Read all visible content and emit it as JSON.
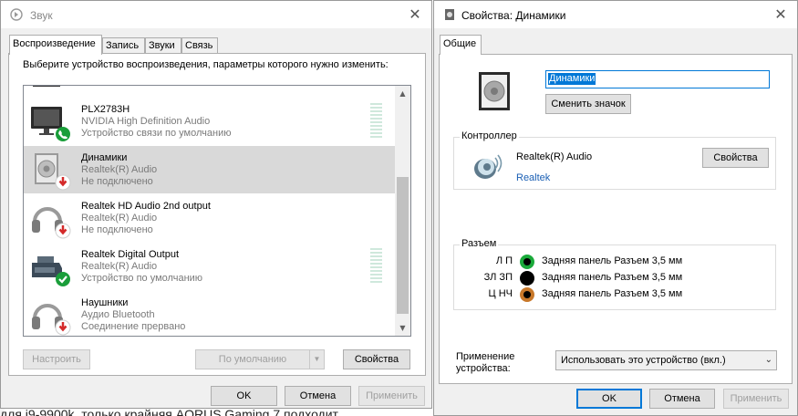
{
  "background": {
    "text": "для i9-9900k, только крайняя AORUS Gaming 7 подходит"
  },
  "sound_window": {
    "title": "Звук",
    "tabs": [
      "Воспроизведение",
      "Запись",
      "Звуки",
      "Связь"
    ],
    "instruction": "Выберите устройство воспроизведения, параметры которого нужно изменить:",
    "devices": [
      {
        "name": "PLX2783H",
        "sub": "NVIDIA High Definition Audio",
        "status": "Устройство связи по умолчанию",
        "icon": "monitor-phone-icon"
      },
      {
        "name": "Динамики",
        "sub": "Realtek(R) Audio",
        "status": "Не подключено",
        "icon": "speaker-disconnected-icon"
      },
      {
        "name": "Realtek HD Audio 2nd output",
        "sub": "Realtek(R) Audio",
        "status": "Не подключено",
        "icon": "headphones-disconnected-icon"
      },
      {
        "name": "Realtek Digital Output",
        "sub": "Realtek(R) Audio",
        "status": "Устройство по умолчанию",
        "icon": "digital-output-default-icon"
      },
      {
        "name": "Наушники",
        "sub": "Аудио Bluetooth",
        "status": "Соединение прервано",
        "icon": "headphones-disconnected-icon"
      }
    ],
    "buttons": {
      "configure": "Настроить",
      "set_default": "По умолчанию",
      "properties": "Свойства",
      "ok": "OK",
      "cancel": "Отмена",
      "apply": "Применить"
    }
  },
  "props_window": {
    "title": "Свойства: Динамики",
    "tab": "Общие",
    "name_value": "Динамики",
    "change_icon": "Сменить значок",
    "controller": {
      "label": "Контроллер",
      "name": "Realtek(R) Audio",
      "vendor": "Realtek",
      "properties_button": "Свойства"
    },
    "jacks": {
      "label": "Разъем",
      "items": [
        {
          "channel": "Л П",
          "desc": "Задняя панель Разъем 3,5 мм",
          "color": "#1aaa3a"
        },
        {
          "channel": "ЗЛ ЗП",
          "desc": "Задняя панель Разъем 3,5 мм",
          "color": "#000000"
        },
        {
          "channel": "Ц НЧ",
          "desc": "Задняя панель Разъем 3,5 мм",
          "color": "#c8782a"
        }
      ]
    },
    "usage": {
      "label_line1": "Применение",
      "label_line2": "устройства:",
      "value": "Использовать это устройство (вкл.)"
    },
    "buttons": {
      "ok": "OK",
      "cancel": "Отмена",
      "apply": "Применить"
    }
  },
  "colors": {
    "accent": "#0078d7",
    "selection": "#d9d9d9",
    "green_badge": "#1a9e3a",
    "red_badge": "#d42a2a"
  }
}
